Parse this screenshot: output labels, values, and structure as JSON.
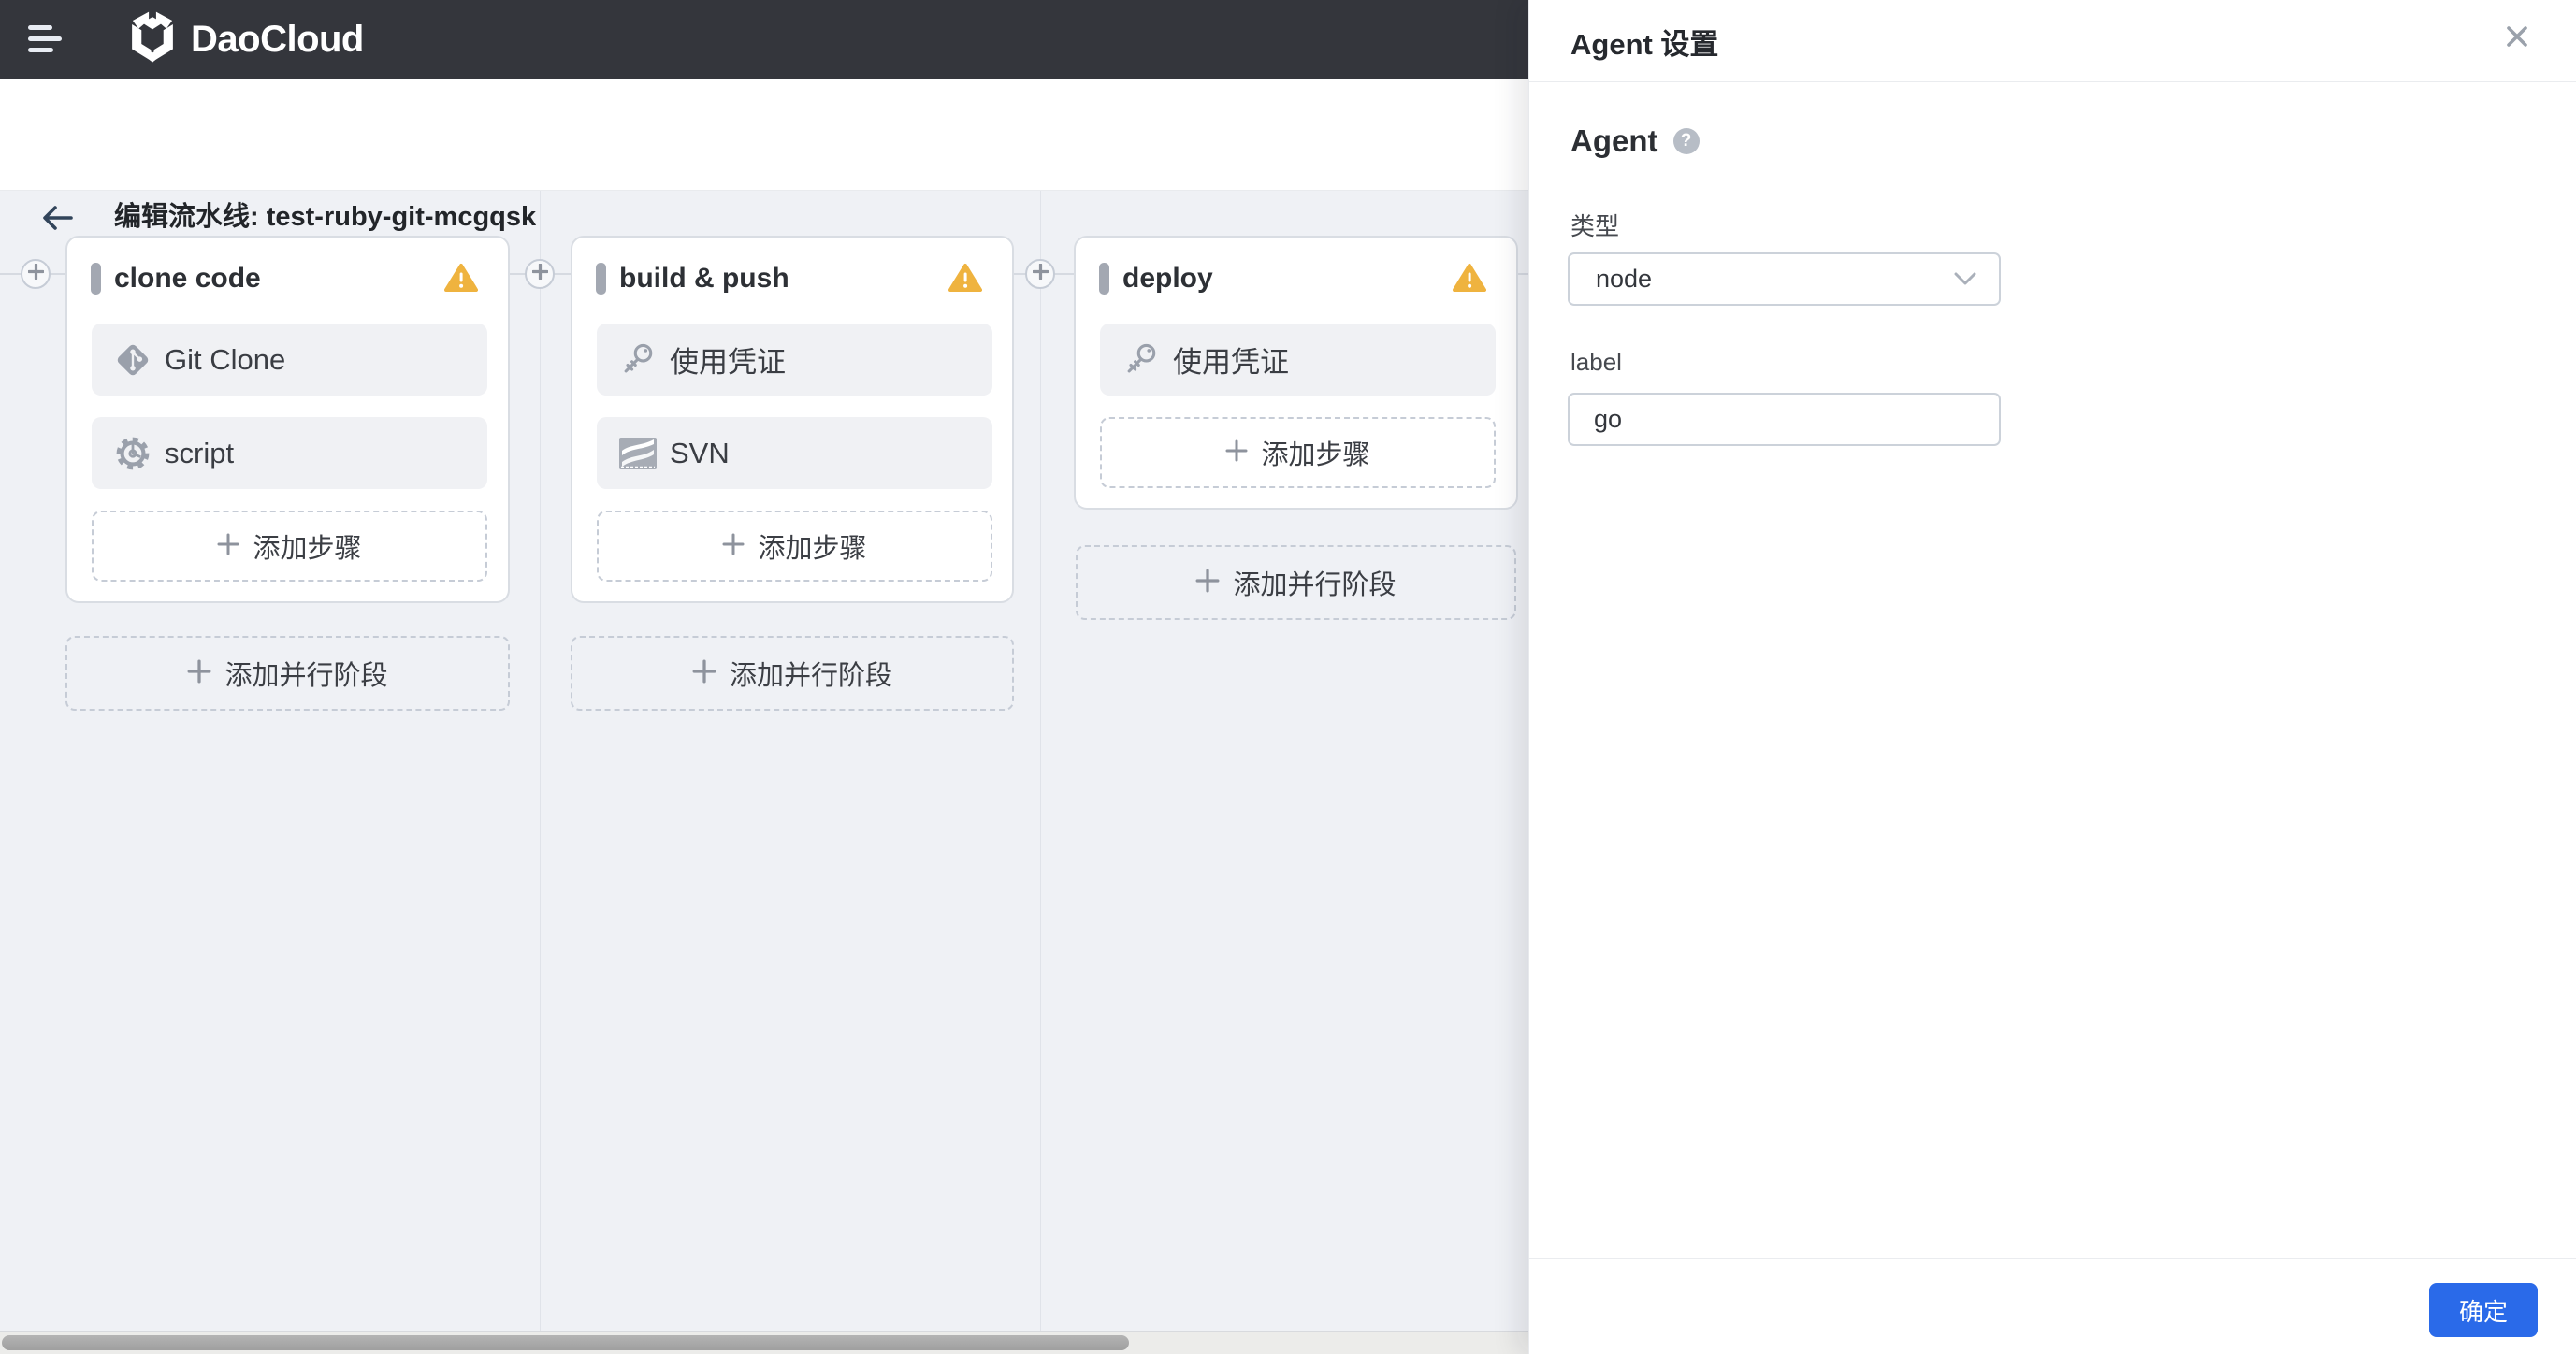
{
  "navbar": {
    "brand": "DaoCloud"
  },
  "titlebar": {
    "title": "编辑流水线: test-ruby-git-mcgqsk"
  },
  "canvas": {
    "add_step_label": "添加步骤",
    "add_parallel_label": "添加并行阶段",
    "stages": [
      {
        "name": "clone code",
        "steps": [
          {
            "label": "Git Clone",
            "icon": "git-icon"
          },
          {
            "label": "script",
            "icon": "gear-icon"
          }
        ]
      },
      {
        "name": "build & push",
        "steps": [
          {
            "label": "使用凭证",
            "icon": "key-icon"
          },
          {
            "label": "SVN",
            "icon": "svn-icon"
          }
        ]
      },
      {
        "name": "deploy",
        "steps": [
          {
            "label": "使用凭证",
            "icon": "key-icon"
          }
        ]
      }
    ]
  },
  "panel": {
    "title": "Agent 设置",
    "section_title": "Agent",
    "help_glyph": "?",
    "type_field": {
      "label": "类型",
      "value": "node"
    },
    "label_field": {
      "label": "label",
      "value": "go"
    },
    "confirm_label": "确定"
  },
  "colors": {
    "navbar_bg": "#34363c",
    "accent_blue": "#2a6ae9",
    "warning": "#efb33f",
    "canvas_bg": "#eff1f5"
  }
}
